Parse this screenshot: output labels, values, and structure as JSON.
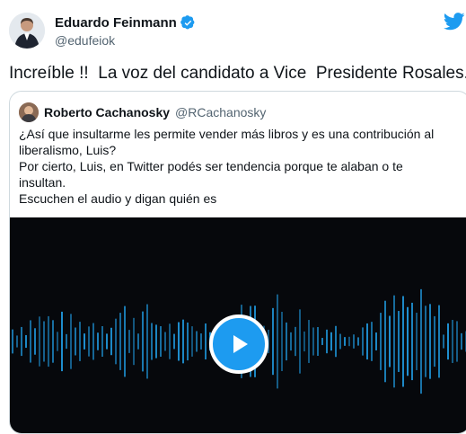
{
  "author": {
    "name": "Eduardo Feinmann",
    "handle": "@edufeiok"
  },
  "tweet_text": "Increíble !!  La voz del candidato a Vice  Presidente Rosales.",
  "quoted": {
    "name": "Roberto Cachanosky",
    "handle": "@RCachanosky",
    "lines": [
      "¿Así que insultarme les permite vender más libros y es una contribución al",
      "liberalismo, Luis?",
      "Por cierto, Luis, en Twitter podés ser tendencia porque te alaban o te",
      "insultan.",
      "Escuchen el audio y digan quién es"
    ]
  },
  "colors": {
    "accent": "#1d9bf0",
    "wave": "#1e8fd0",
    "media_bg": "#06080c"
  },
  "icons": [
    "verified-badge-icon",
    "twitter-bird-icon",
    "play-icon"
  ]
}
